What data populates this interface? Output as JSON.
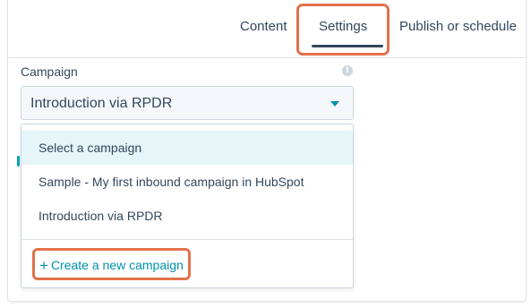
{
  "tabs": [
    {
      "label": "Content"
    },
    {
      "label": "Settings"
    },
    {
      "label": "Publish or schedule"
    }
  ],
  "active_tab": "Settings",
  "campaign": {
    "label": "Campaign",
    "selected_value": "Introduction via RPDR",
    "info_icon": "info-icon",
    "dropdown_icon": "caret-down-icon"
  },
  "dropdown": {
    "options": [
      {
        "label": "Select a campaign"
      },
      {
        "label": "Sample - My first inbound campaign in HubSpot"
      },
      {
        "label": "Introduction via RPDR"
      }
    ],
    "create_label": "Create a new campaign",
    "create_icon": "plus-icon"
  },
  "colors": {
    "highlight": "#e2714b",
    "link": "#0091ae",
    "text": "#33475b",
    "selected_bg": "#e5f5f8"
  }
}
